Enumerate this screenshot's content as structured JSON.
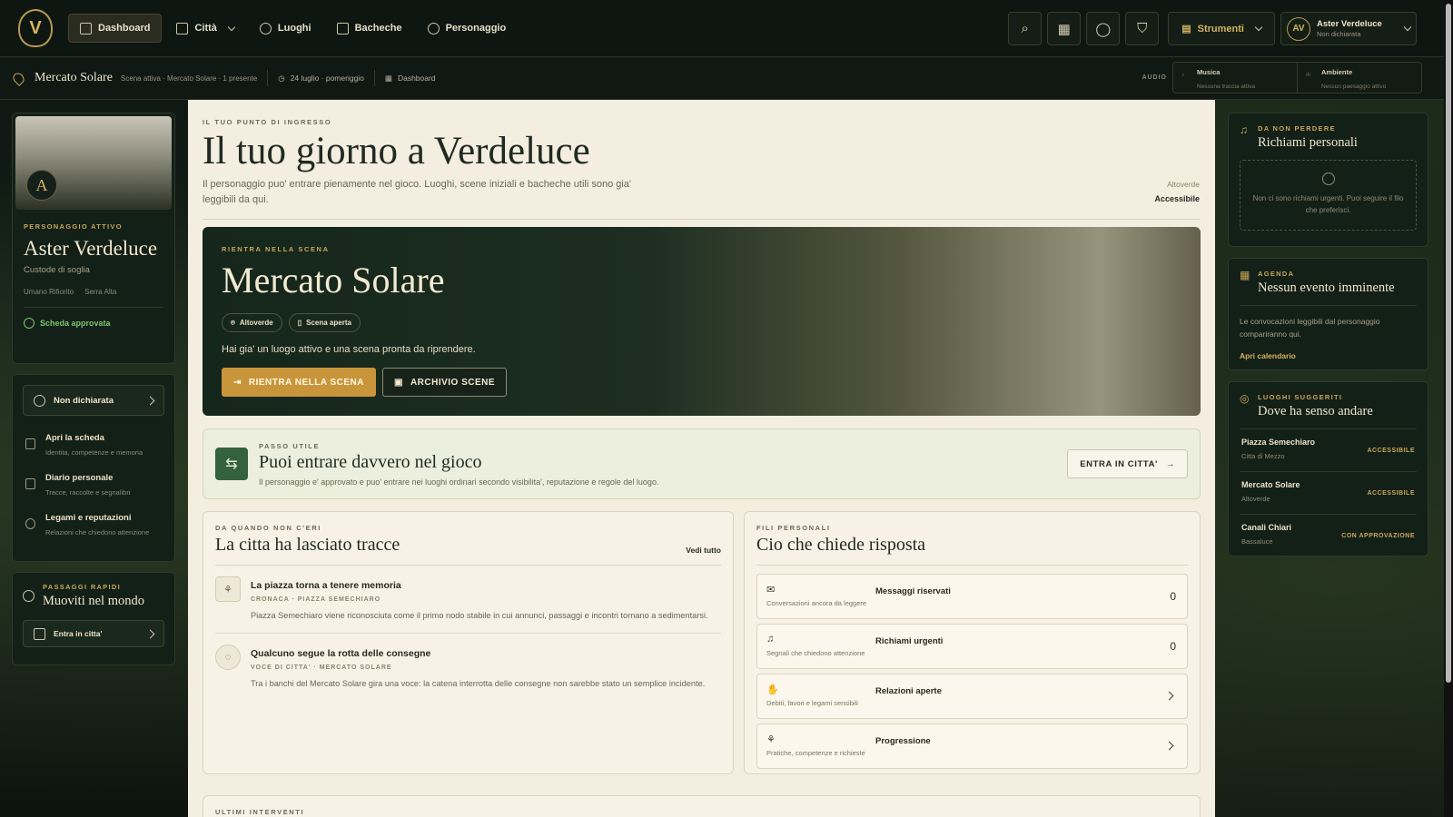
{
  "topbar": {
    "logo": "V",
    "nav": [
      {
        "label": "Dashboard",
        "active": true
      },
      {
        "label": "Città",
        "dropdown": true
      },
      {
        "label": "Luoghi"
      },
      {
        "label": "Bacheche"
      },
      {
        "label": "Personaggio"
      }
    ],
    "strumenti": "Strumenti",
    "user": {
      "initials": "AV",
      "name": "Aster Verdeluce",
      "status": "Non dichiarata"
    },
    "icons": [
      "search-icon",
      "calendar-icon",
      "chat-icon",
      "shield-icon"
    ]
  },
  "subbar": {
    "scene": "Mercato Solare",
    "scene_sub": "Scena attiva · Mercato Solare · 1 presente",
    "date": "24 luglio · pomeriggio",
    "crumb": "Dashboard",
    "audio_label": "AUDIO",
    "music": {
      "title": "Musica",
      "sub": "Nessuna traccia attiva"
    },
    "ambient": {
      "title": "Ambiente",
      "sub": "Nessun paesaggio attivo"
    }
  },
  "left": {
    "avatar_letter": "A",
    "eyebrow": "Personaggio attivo",
    "name": "Aster Verdeluce",
    "role": "Custode di soglia",
    "tags": [
      "Umano Rifiorito",
      "Serra Alta"
    ],
    "approved": "Scheda approvata",
    "status_btn": "Non dichiarata",
    "items": [
      {
        "title": "Apri la scheda",
        "sub": "Identita, competenze e memoria"
      },
      {
        "title": "Diario personale",
        "sub": "Tracce, raccolte e segnalibri"
      },
      {
        "title": "Legami e reputazioni",
        "sub": "Relazioni che chiedono attenzione"
      }
    ],
    "quick_eyebrow": "Passaggi rapidi",
    "quick_title": "Muoviti nel mondo",
    "quick_btn": "Entra in citta'"
  },
  "main": {
    "kicker": "Il tuo punto di ingresso",
    "title": "Il tuo giorno a Verdeluce",
    "lead": "Il personaggio puo' entrare pienamente nel gioco. Luoghi, scene iniziali e bacheche utili sono gia' leggibili da qui.",
    "loc_label": "Altoverde",
    "loc_status": "Accessibile",
    "hero": {
      "kicker": "Rientra nella scena",
      "title": "Mercato Solare",
      "chips": [
        "Altoverde",
        "Scena aperta"
      ],
      "text": "Hai gia' un luogo attivo e una scena pronta da riprendere.",
      "primary": "RIENTRA NELLA SCENA",
      "secondary": "ARCHIVIO SCENE"
    },
    "step": {
      "kicker": "Passo utile",
      "title": "Puoi entrare davvero nel gioco",
      "text": "Il personaggio e' approvato e puo' entrare nei luoghi ordinari secondo visibilita', reputazione e regole del luogo.",
      "btn": "ENTRA IN CITTA'"
    },
    "news": {
      "kicker": "Da quando non c'eri",
      "title": "La citta ha lasciato tracce",
      "link": "Vedi tutto",
      "items": [
        {
          "title": "La piazza torna a tenere memoria",
          "kicker": "CRONACA · PIAZZA SEMECHIARO",
          "text": "Piazza Semechiaro viene riconosciuta come il primo nodo stabile in cui annunci, passaggi e incontri tornano a sedimentarsi."
        },
        {
          "title": "Qualcuno segue la rotta delle consegne",
          "kicker": "VOCE DI CITTA' · MERCATO SOLARE",
          "text": "Tra i banchi del Mercato Solare gira una voce: la catena interrotta delle consegne non sarebbe stato un semplice incidente."
        }
      ]
    },
    "threads": {
      "kicker": "Fili personali",
      "title": "Cio che chiede risposta",
      "items": [
        {
          "title": "Messaggi riservati",
          "sub": "Conversazioni ancora da leggere",
          "value": "0"
        },
        {
          "title": "Richiami urgenti",
          "sub": "Segnali che chiedono attenzione",
          "value": "0"
        },
        {
          "title": "Relazioni aperte",
          "sub": "Debiti, favori e legami sensibili"
        },
        {
          "title": "Progressione",
          "sub": "Pratiche, competenze e richieste"
        }
      ]
    },
    "ultimi": "Ultimi interventi"
  },
  "right": {
    "reminders": {
      "eyebrow": "Da non perdere",
      "title": "Richiami personali",
      "empty": "Non ci sono richiami urgenti. Puoi seguire il filo che preferisci."
    },
    "agenda": {
      "eyebrow": "Agenda",
      "title": "Nessun evento imminente",
      "text": "Le convocazioni leggibili dal personaggio compariranno qui.",
      "link": "Apri calendario"
    },
    "places": {
      "eyebrow": "Luoghi suggeriti",
      "title": "Dove ha senso andare",
      "items": [
        {
          "name": "Piazza Semechiaro",
          "area": "Citta di Mezzo",
          "status": "ACCESSIBILE"
        },
        {
          "name": "Mercato Solare",
          "area": "Altoverde",
          "status": "ACCESSIBILE"
        },
        {
          "name": "Canali Chiari",
          "area": "Bassaluce",
          "status": "CON APPROVAZIONE"
        }
      ]
    }
  }
}
